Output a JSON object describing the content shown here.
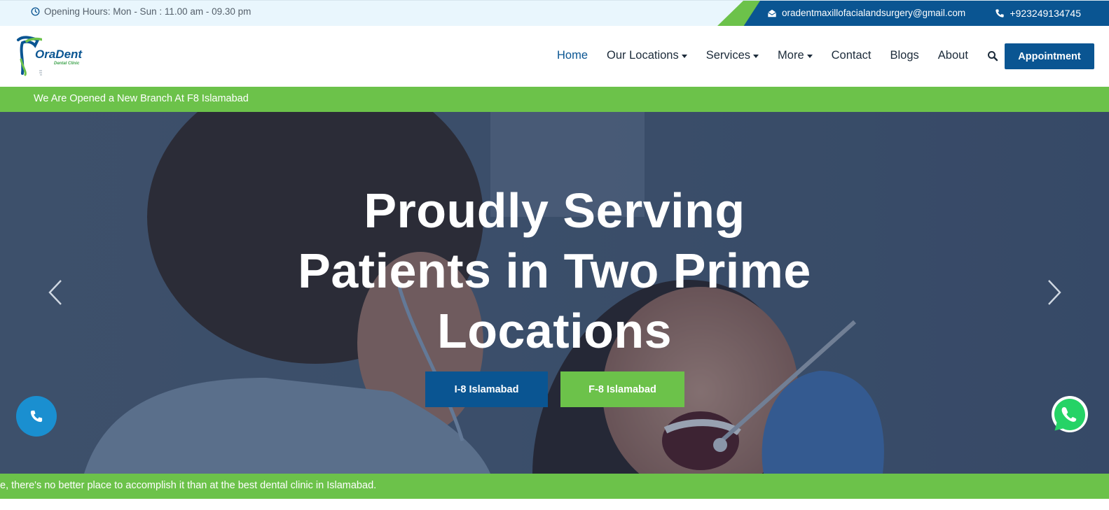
{
  "topbar": {
    "hours": "Opening Hours: Mon - Sun : 11.00 am - 09.30 pm",
    "email": "oradentmaxillofacialandsurgery@gmail.com",
    "phone": "+923249134745"
  },
  "logo": {
    "name": "OraDent",
    "tagline": "Dental Clinic"
  },
  "nav": {
    "items": [
      {
        "label": "Home",
        "active": true,
        "dropdown": false
      },
      {
        "label": "Our Locations",
        "active": false,
        "dropdown": true
      },
      {
        "label": "Services",
        "active": false,
        "dropdown": true
      },
      {
        "label": "More",
        "active": false,
        "dropdown": true
      },
      {
        "label": "Contact",
        "active": false,
        "dropdown": false
      },
      {
        "label": "Blogs",
        "active": false,
        "dropdown": false
      },
      {
        "label": "About",
        "active": false,
        "dropdown": false
      }
    ],
    "search_icon": "search-icon",
    "cta_label": "Appointment"
  },
  "announcement": "We Are Opened a New Branch At F8 Islamabad",
  "hero": {
    "headline_line1": "Proudly Serving",
    "headline_line2": "Patients in Two Prime",
    "headline_line3": "Locations",
    "button_primary": "I-8 Islamabad",
    "button_secondary": "F-8 Islamabad"
  },
  "ticker": "e, there's no better place to accomplish it than at the best dental clinic in Islamabad.",
  "colors": {
    "brand_blue": "#0a5592",
    "brand_green": "#6cc24a",
    "topbar_bg": "#e9f6fd",
    "call_button": "#1a8fd0",
    "whatsapp": "#25d366"
  }
}
